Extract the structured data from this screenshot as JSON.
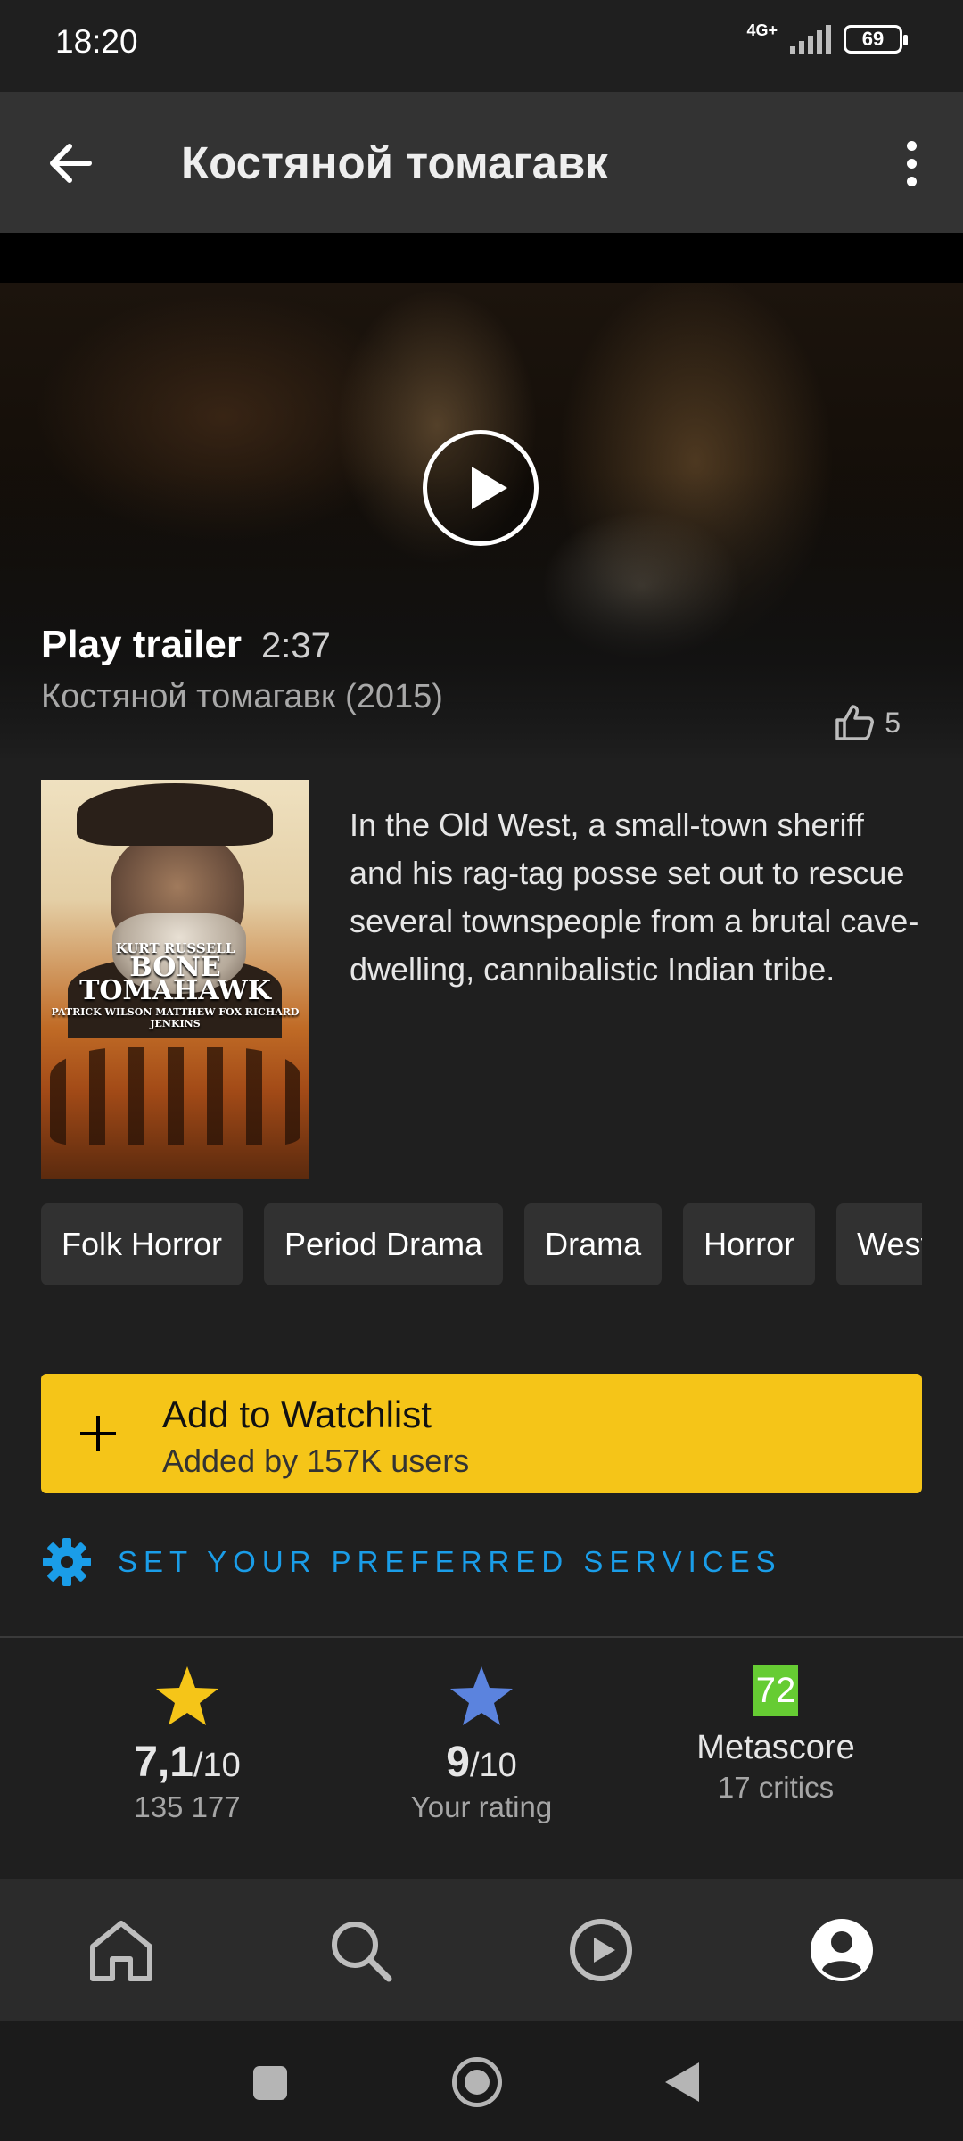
{
  "status_bar": {
    "time": "18:20",
    "network": "4G+",
    "battery": "69"
  },
  "app_bar": {
    "title": "Костяной томагавк",
    "back_icon": "arrow-left-icon",
    "more_icon": "more-vertical-icon"
  },
  "trailer": {
    "label": "Play trailer",
    "duration": "2:37",
    "subtitle": "Костяной томагавк (2015)",
    "likes": "5",
    "play_icon": "play-circle-icon"
  },
  "poster": {
    "top_billing": "KURT RUSSELL",
    "title_line1": "BONE",
    "title_line2": "TOMAHAWK",
    "cast_line": "PATRICK WILSON   MATTHEW FOX   RICHARD JENKINS"
  },
  "plot": "In the Old West, a small-town sheriff and his rag-tag posse set out to rescue several townspeople from a brutal cave-dwelling, cannibalistic Indian tribe.",
  "genres": [
    "Folk Horror",
    "Period Drama",
    "Drama",
    "Horror",
    "Western"
  ],
  "watchlist": {
    "title": "Add to Watchlist",
    "subtitle": "Added by 157K users",
    "icon": "plus-icon",
    "color": "#F5C518"
  },
  "services": {
    "label": "SET YOUR PREFERRED SERVICES",
    "icon": "gear-icon",
    "color": "#1A9DE8"
  },
  "ratings": {
    "imdb": {
      "value": "7,1",
      "scale": "/10",
      "count": "135 177",
      "icon": "star-icon",
      "color": "#F5C518"
    },
    "user": {
      "value": "9",
      "scale": "/10",
      "label": "Your rating",
      "icon": "star-icon",
      "color": "#5B83DE"
    },
    "metascore": {
      "value": "72",
      "label": "Metascore",
      "critics": "17 critics",
      "color": "#66CC33"
    }
  },
  "bottom_nav": {
    "items": [
      {
        "icon": "home-icon"
      },
      {
        "icon": "search-icon"
      },
      {
        "icon": "play-video-icon"
      },
      {
        "icon": "profile-icon",
        "active": true
      }
    ]
  }
}
